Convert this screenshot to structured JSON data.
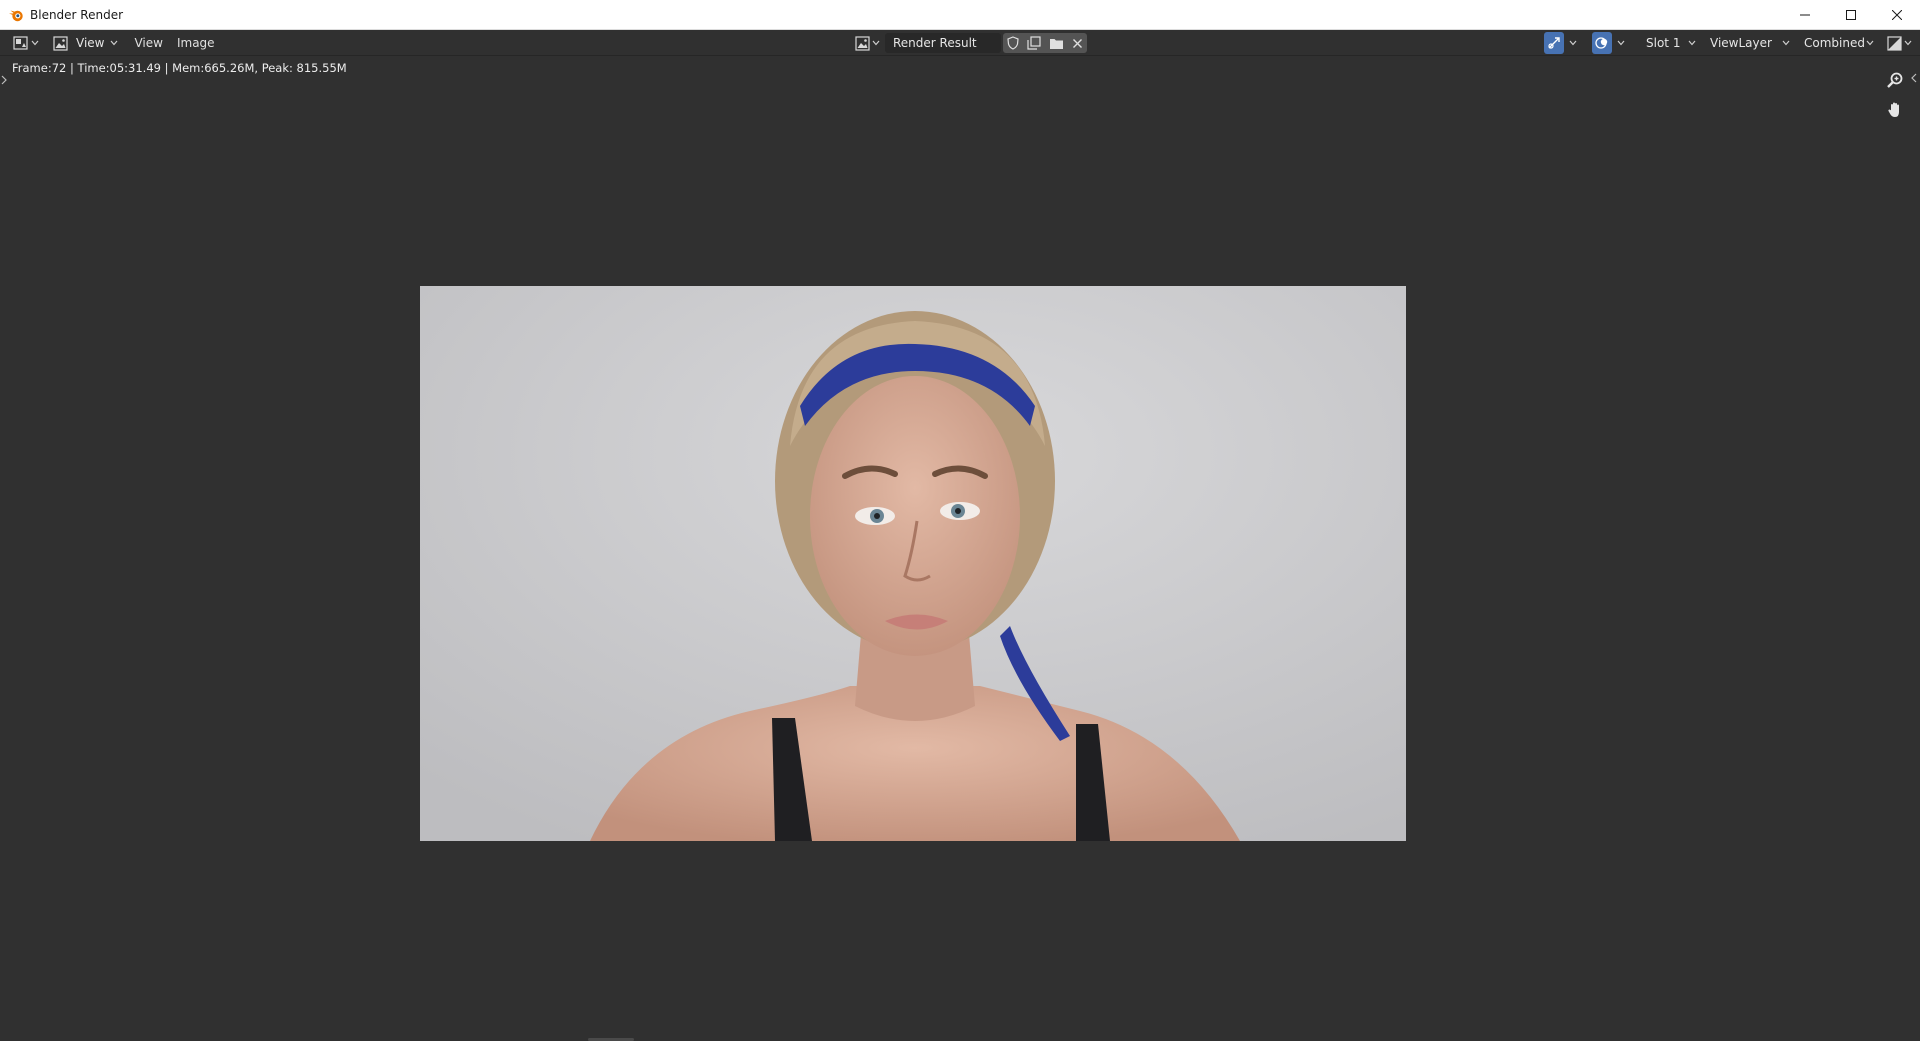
{
  "window": {
    "title": "Blender Render",
    "icon": "blender-logo-icon",
    "controls": [
      "minimize-icon",
      "maximize-icon",
      "close-icon"
    ]
  },
  "header": {
    "editor_type_icon": "image-editor-icon",
    "mode_icon": "image-icon",
    "mode_label": "View",
    "menus": [
      "View",
      "Image"
    ],
    "image_browse_icon": "image-browse-icon",
    "image_name": "Render Result",
    "image_actions": [
      "fake-user-shield-icon",
      "duplicate-image-icon",
      "open-folder-icon",
      "unlink-close-icon"
    ],
    "gizmo_icon": "gizmo-icon",
    "overlay_icon": "overlay-icon",
    "slot": "Slot 1",
    "view_layer": "ViewLayer",
    "pass": "Combined",
    "display_channels_icon": "display-channels-icon"
  },
  "viewport": {
    "stats": "Frame:72 | Time:05:31.49 | Mem:665.26M, Peak: 815.55M",
    "nav_tools": [
      "zoom-icon",
      "pan-hand-icon"
    ]
  },
  "colors": {
    "background": "#303030",
    "header": "#303030",
    "field": "#282828",
    "segmented": "#545454",
    "accent_blue": "#4772b3",
    "titlebar": "#ffffff"
  }
}
